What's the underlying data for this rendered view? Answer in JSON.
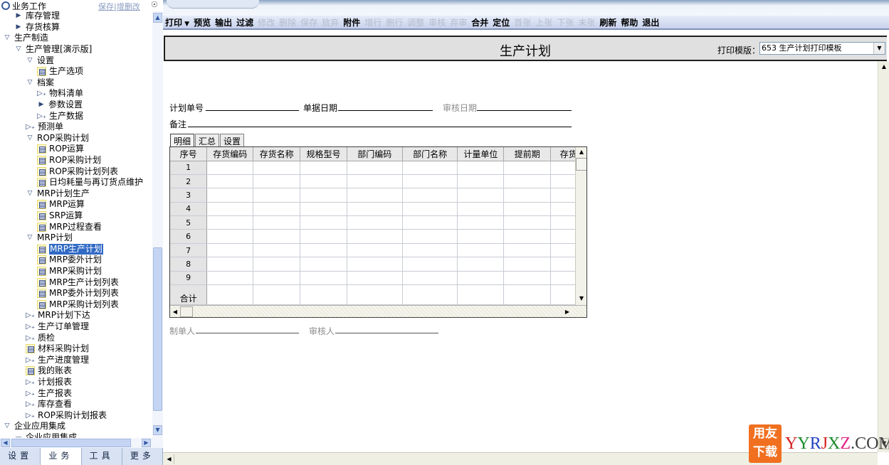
{
  "nav": {
    "header_title": "业务工作",
    "header_links": "保存|增删改",
    "tree": [
      {
        "label": "库存管理",
        "level": 1,
        "icon": "expand-right"
      },
      {
        "label": "存货核算",
        "level": 1,
        "icon": "expand-right"
      },
      {
        "label": "生产制造",
        "level": 0,
        "icon": "expand-down"
      },
      {
        "label": "生产管理[演示版]",
        "level": 1,
        "icon": "expand-down"
      },
      {
        "label": "设置",
        "level": 2,
        "icon": "expand-down"
      },
      {
        "label": "生产选项",
        "level": 3,
        "icon": "doc"
      },
      {
        "label": "档案",
        "level": 2,
        "icon": "expand-down"
      },
      {
        "label": "物料清单",
        "level": 3,
        "icon": "group"
      },
      {
        "label": "参数设置",
        "level": 3,
        "icon": "expand-right"
      },
      {
        "label": "生产数据",
        "level": 3,
        "icon": "group"
      },
      {
        "label": "预测单",
        "level": 2,
        "icon": "group"
      },
      {
        "label": "ROP采购计划",
        "level": 2,
        "icon": "expand-down"
      },
      {
        "label": "ROP运算",
        "level": 3,
        "icon": "doc"
      },
      {
        "label": "ROP采购计划",
        "level": 3,
        "icon": "doc"
      },
      {
        "label": "ROP采购计划列表",
        "level": 3,
        "icon": "doc"
      },
      {
        "label": "日均耗量与再订货点维护",
        "level": 3,
        "icon": "doc"
      },
      {
        "label": "MRP计划生产",
        "level": 2,
        "icon": "expand-down"
      },
      {
        "label": "MRP运算",
        "level": 3,
        "icon": "doc"
      },
      {
        "label": "SRP运算",
        "level": 3,
        "icon": "doc"
      },
      {
        "label": "MRP过程查看",
        "level": 3,
        "icon": "doc"
      },
      {
        "label": "MRP计划",
        "level": 2,
        "icon": "expand-down"
      },
      {
        "label": "MRP生产计划",
        "level": 3,
        "icon": "doc",
        "selected": true
      },
      {
        "label": "MRP委外计划",
        "level": 3,
        "icon": "doc"
      },
      {
        "label": "MRP采购计划",
        "level": 3,
        "icon": "doc"
      },
      {
        "label": "MRP生产计划列表",
        "level": 3,
        "icon": "doc"
      },
      {
        "label": "MRP委外计划列表",
        "level": 3,
        "icon": "doc"
      },
      {
        "label": "MRP采购计划列表",
        "level": 3,
        "icon": "doc"
      },
      {
        "label": "MRP计划下达",
        "level": 2,
        "icon": "group"
      },
      {
        "label": "生产订单管理",
        "level": 2,
        "icon": "group"
      },
      {
        "label": "质检",
        "level": 2,
        "icon": "group"
      },
      {
        "label": "材料采购计划",
        "level": 2,
        "icon": "doc"
      },
      {
        "label": "生产进度管理",
        "level": 2,
        "icon": "group"
      },
      {
        "label": "我的账表",
        "level": 2,
        "icon": "doc"
      },
      {
        "label": "计划报表",
        "level": 2,
        "icon": "group"
      },
      {
        "label": "生产报表",
        "level": 2,
        "icon": "group"
      },
      {
        "label": "库存查看",
        "level": 2,
        "icon": "group"
      },
      {
        "label": "ROP采购计划报表",
        "level": 2,
        "icon": "group"
      },
      {
        "label": "企业应用集成",
        "level": 0,
        "icon": "expand-down"
      },
      {
        "label": "企业应用集成",
        "level": 1,
        "icon": "minus",
        "partial": true
      }
    ],
    "bottom_tabs": [
      {
        "label": "设置",
        "active": false
      },
      {
        "label": "业务",
        "active": true
      },
      {
        "label": "工具",
        "active": false
      },
      {
        "label": "更多",
        "active": false
      }
    ]
  },
  "toolbar": {
    "buttons": [
      {
        "label": "打印",
        "enabled": true,
        "has_dropdown": true
      },
      {
        "label": "预览",
        "enabled": true
      },
      {
        "label": "输出",
        "enabled": true
      },
      {
        "label": "过滤",
        "enabled": true
      },
      {
        "label": "修改",
        "enabled": false
      },
      {
        "label": "删除",
        "enabled": false
      },
      {
        "label": "保存",
        "enabled": false
      },
      {
        "label": "放弃",
        "enabled": false
      },
      {
        "label": "附件",
        "enabled": true
      },
      {
        "label": "增行",
        "enabled": false
      },
      {
        "label": "删行",
        "enabled": false
      },
      {
        "label": "调整",
        "enabled": false
      },
      {
        "label": "审核",
        "enabled": false
      },
      {
        "label": "弃审",
        "enabled": false
      },
      {
        "label": "合并",
        "enabled": true
      },
      {
        "label": "定位",
        "enabled": true
      },
      {
        "label": "首张",
        "enabled": false
      },
      {
        "label": "上张",
        "enabled": false
      },
      {
        "label": "下张",
        "enabled": false
      },
      {
        "label": "末张",
        "enabled": false
      },
      {
        "label": "刷新",
        "enabled": true
      },
      {
        "label": "帮助",
        "enabled": true
      },
      {
        "label": "退出",
        "enabled": true
      }
    ]
  },
  "form": {
    "title": "生产计划",
    "print_template_label": "打印模版：",
    "print_template_value": "653 生产计划打印模板",
    "fields": {
      "plan_no_label": "计划单号",
      "plan_no_value": "",
      "doc_date_label": "单据日期",
      "doc_date_value": "",
      "audit_date_label": "审核日期",
      "audit_date_value": "",
      "remark_label": "备注",
      "remark_value": "",
      "maker_label": "制单人",
      "maker_value": "",
      "auditor_label": "审核人",
      "auditor_value": ""
    },
    "subtabs": [
      {
        "label": "明细",
        "active": true
      },
      {
        "label": "汇总",
        "active": false
      },
      {
        "label": "设置",
        "active": false
      }
    ],
    "grid": {
      "columns": [
        "序号",
        "存货编码",
        "存货名称",
        "规格型号",
        "部门编码",
        "部门名称",
        "计量单位",
        "提前期",
        "存货"
      ],
      "row_numbers": [
        "1",
        "2",
        "3",
        "4",
        "5",
        "6",
        "7",
        "8",
        "9"
      ],
      "total_label": "合计"
    }
  },
  "watermark": {
    "badge_line1": "用友",
    "badge_line2": "下载",
    "site": "YYRJXZ.COM",
    "site_colors": [
      "#d42020",
      "#1a8a2a",
      "#2040c0",
      "#d42020",
      "#1a8a2a",
      "#e02080",
      "#404040",
      "#404040",
      "#404040",
      "#404040"
    ]
  }
}
